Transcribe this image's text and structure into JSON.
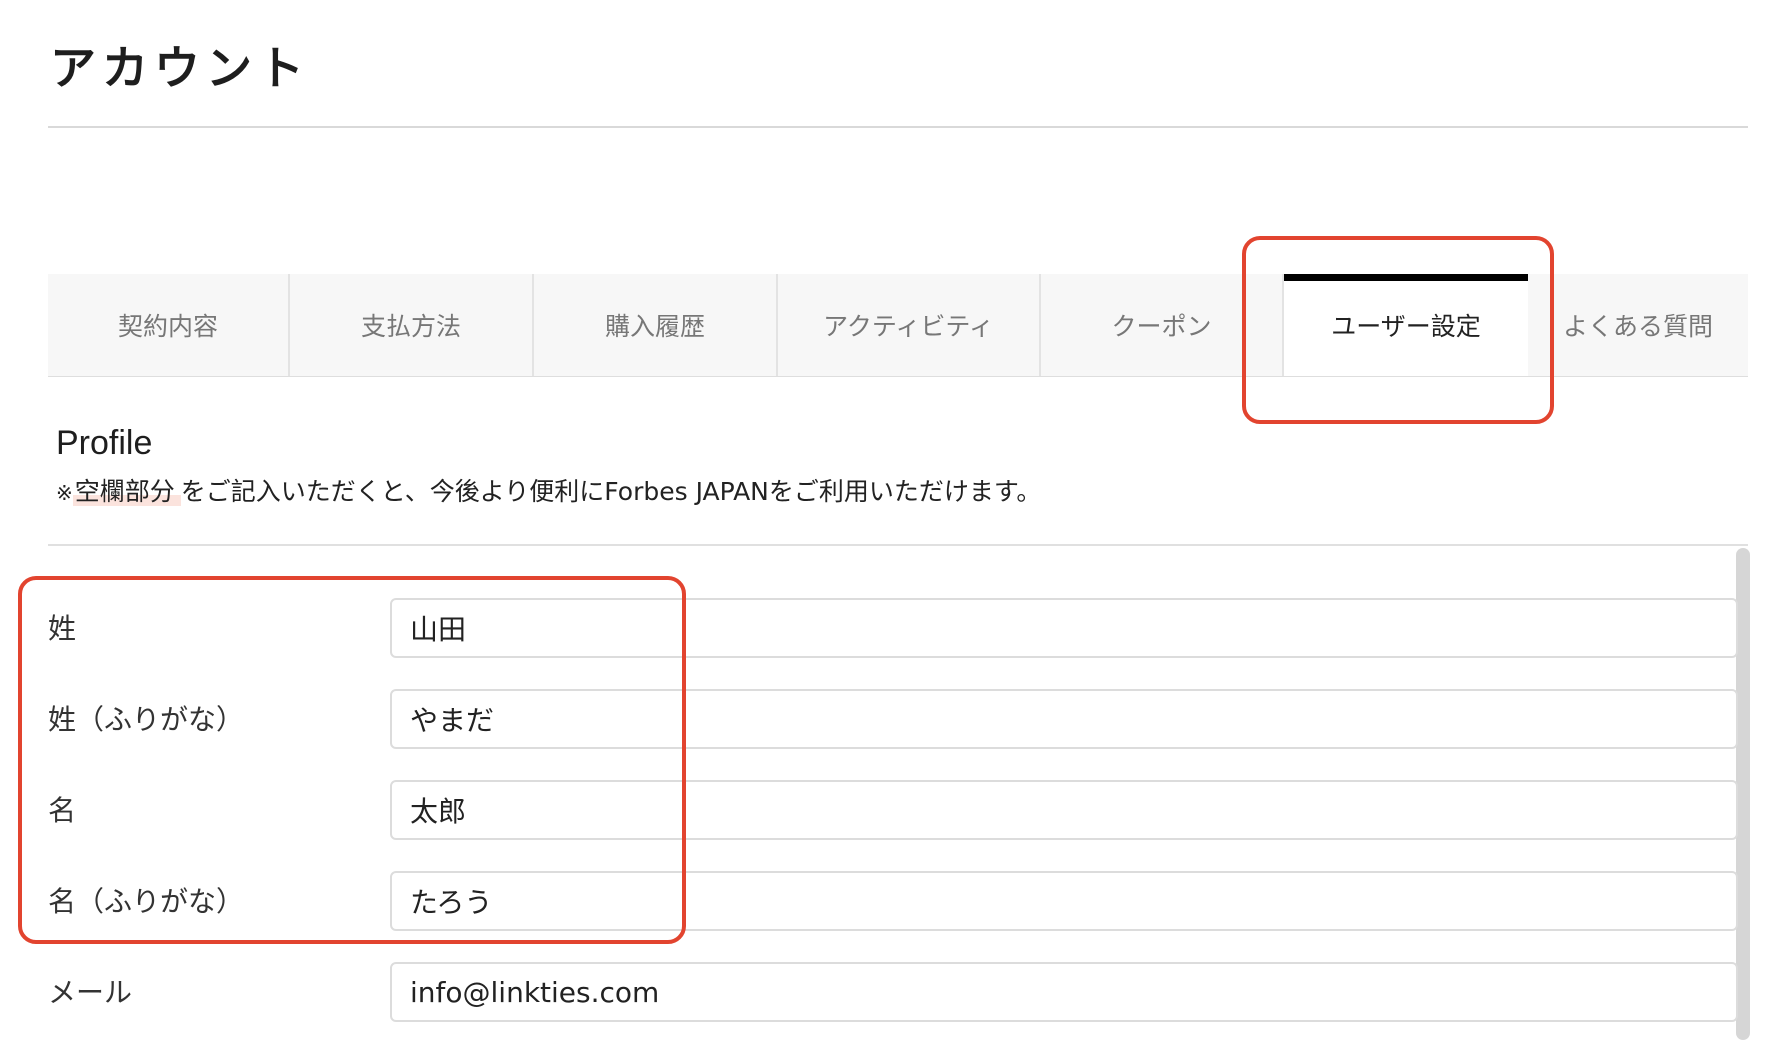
{
  "header": {
    "title": "アカウント"
  },
  "tabs": [
    {
      "label": "契約内容",
      "active": false
    },
    {
      "label": "支払方法",
      "active": false
    },
    {
      "label": "購入履歴",
      "active": false
    },
    {
      "label": "アクティビティ",
      "active": false
    },
    {
      "label": "クーポン",
      "active": false
    },
    {
      "label": "ユーザー設定",
      "active": true
    },
    {
      "label": "よくある質問",
      "active": false
    }
  ],
  "profile": {
    "heading": "Profile",
    "note_mark": "※",
    "note_emphasis": "空欄部分",
    "note_text": "をご記入いただくと、今後より便利にForbes JAPANをご利用いただけます。"
  },
  "form": {
    "fields": [
      {
        "label": "姓",
        "value": "山田"
      },
      {
        "label": "姓（ふりがな）",
        "value": "やまだ"
      },
      {
        "label": "名",
        "value": "太郎"
      },
      {
        "label": "名（ふりがな）",
        "value": "たろう"
      },
      {
        "label": "メール",
        "value": "info@linkties.com"
      }
    ]
  },
  "colors": {
    "highlight": "#e2442f",
    "active_tab_indicator": "#000000",
    "tab_background": "#f7f7f7"
  }
}
